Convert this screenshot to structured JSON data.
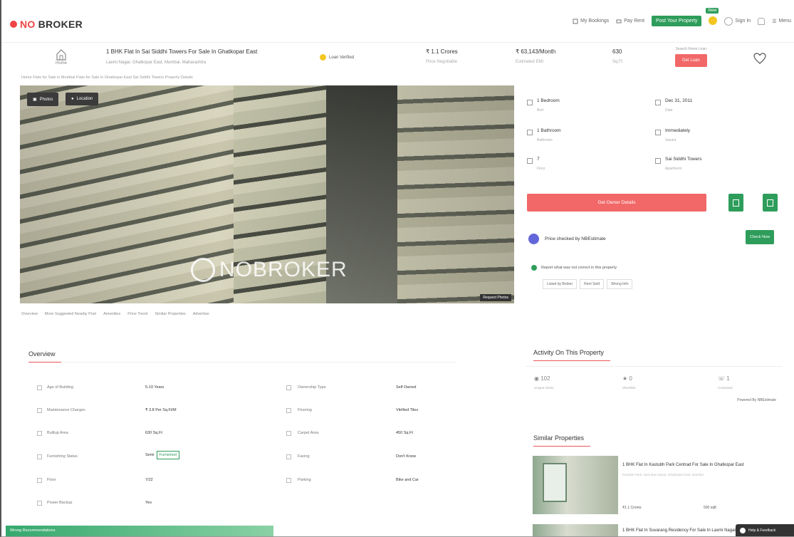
{
  "nav": {
    "logo_no": "NO",
    "logo_broker": "BROKER",
    "links": [
      "My Bookings",
      "Pay Rent"
    ],
    "post_property": "Post Your Property",
    "new_tag": "New",
    "sign_in": "Sign In",
    "menu": "Menu"
  },
  "header": {
    "home_label": "Home",
    "title": "1 BHK Flat In Sai Siddhi Towers For Sale In Ghatkopar East",
    "address": "Laxmi Nagar, Ghatkopar East, Mumbai, Maharashtra",
    "verified": "Loan Verified",
    "price": "₹ 1.1 Crores",
    "price_sub": "Price Negotiable",
    "emi": "₹ 63,143/Month",
    "emi_sub": "Estimated EMI",
    "area": "630",
    "area_sub": "Sq.Ft",
    "contact_small": "Search Home Loan",
    "contact_btn": "Get Loan"
  },
  "breadcrumb": "Home  Flats for Sale in Mumbai  Flats for Sale in Ghatkopar East  Sai Siddhi Towers  Property Details",
  "hero": {
    "photos_btn": "Photos",
    "location_btn": "Location",
    "watermark": "NOBROKER",
    "request_photos": "Request Photos"
  },
  "tabs": [
    "Overview",
    "More Suggested Nearby Post",
    "Amenities",
    "Price Trend",
    "Similar Properties",
    "Advertise"
  ],
  "details": [
    {
      "label": "1 Bedroom",
      "sub": "Bed"
    },
    {
      "label": "Dec 31, 2011",
      "sub": "Date"
    },
    {
      "label": "1 Bathroom",
      "sub": "Bathroom"
    },
    {
      "label": "Immediately",
      "sub": "Vacant"
    },
    {
      "label": "7",
      "sub": "Floor"
    },
    {
      "label": "Sai Siddhi Towers",
      "sub": "Apartment"
    }
  ],
  "owner_btn": "Get Owner Details",
  "checked_by": "Price checked by NBEstimate",
  "check_now": "Check Now",
  "report": {
    "text": "Report what was not correct in this property",
    "options": [
      "Listed by Broker",
      "Rent Sold",
      "Wrong Info"
    ]
  },
  "overview": {
    "title": "Overview",
    "rows": [
      {
        "label": "Age of Building",
        "value": "5-10 Years",
        "label2": "Ownership Type",
        "value2": "Self Owned"
      },
      {
        "label": "Maintenance Charges",
        "value": "₹ 3.8 Per Sq.Ft/M",
        "label2": "Flooring",
        "value2": "Vitrified Tiles"
      },
      {
        "label": "Builtup Area",
        "value": "630 Sq.Ft",
        "label2": "Carpet Area",
        "value2": "450 Sq.Ft"
      },
      {
        "label": "Furnishing Status",
        "value": "Semi",
        "badge": "Furnished",
        "label2": "Facing",
        "value2": "Don't Know"
      },
      {
        "label": "Floor",
        "value": "7/22",
        "label2": "Parking",
        "value2": "Bike and Car"
      },
      {
        "label": "Power Backup",
        "value": "Yes",
        "label2": "",
        "value2": ""
      }
    ]
  },
  "activity": {
    "title": "Activity On This Property",
    "views": "102",
    "views_sub": "Unique Views",
    "shortlists": "0",
    "shortlists_sub": "Shortlists",
    "contacts": "1",
    "contacts_sub": "Contacted",
    "viewed_by": "Powered By NBEstimate"
  },
  "similar": {
    "title": "Similar Properties",
    "items": [
      {
        "title": "1 BHK Flat In Kastubh Park Centrad For Sale In Ghatkopar East",
        "sub": "Kastubh Park, Near Bus Depot, Ghatkopar East, Mumbai",
        "price": "₹1.1 Crores",
        "area": "500 sqft"
      },
      {
        "title": "1 BHK Flat In Suvarang Residency For Sale In Laxmi Nagar",
        "sub": "",
        "price": "",
        "area": ""
      }
    ]
  },
  "help_btn": "Help & Feedback",
  "green_bar": "Wrong Recommendations"
}
